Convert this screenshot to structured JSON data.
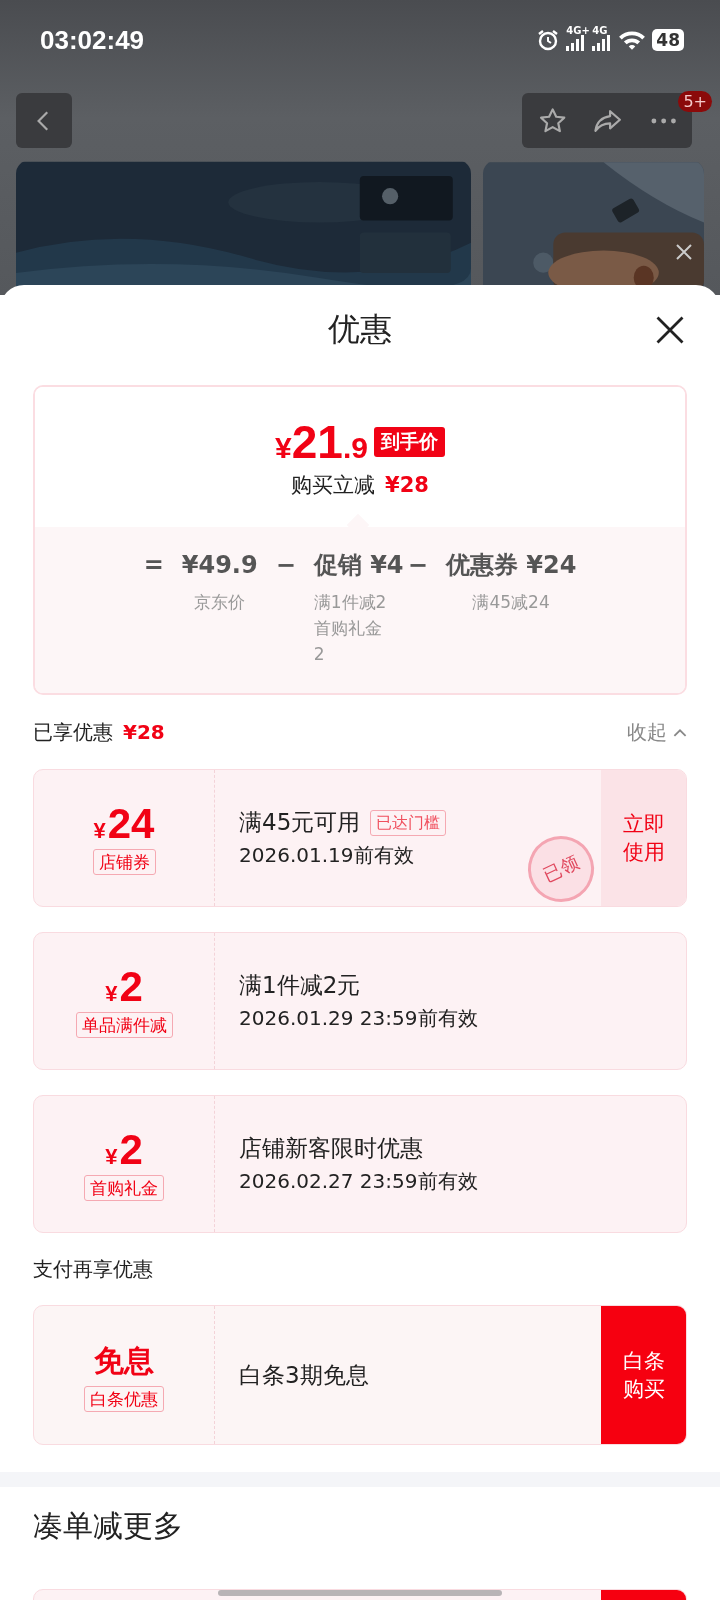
{
  "status_bar": {
    "time": "03:02:49",
    "network": [
      "4G+",
      "4G"
    ],
    "battery": "48"
  },
  "top_bar": {
    "badge": "5+"
  },
  "sheet": {
    "title": "优惠"
  },
  "summary": {
    "currency": "¥",
    "price_int": "21",
    "price_dec": ".9",
    "price_tag": "到手价",
    "saving_label": "购买立减",
    "saving_amount": "¥28",
    "formula": [
      {
        "kind": "operator",
        "text": "="
      },
      {
        "kind": "term",
        "text": "¥49.9",
        "notes": [
          "京东价"
        ]
      },
      {
        "kind": "operator",
        "text": "−"
      },
      {
        "kind": "term",
        "text": "促销 ¥4",
        "notes": [
          "满1件减2",
          "首购礼金2"
        ]
      },
      {
        "kind": "operator",
        "text": "−"
      },
      {
        "kind": "term",
        "text": "优惠券 ¥24",
        "notes": [
          "满45减24"
        ]
      }
    ]
  },
  "applied": {
    "label": "已享优惠",
    "amount": "¥28",
    "toggle": "收起",
    "expanded": true
  },
  "coupons": [
    {
      "currency": "¥",
      "amount": "24",
      "type": "店铺券",
      "title": "满45元可用",
      "tag": "已达门槛",
      "validity": "2026.01.19前有效",
      "action": {
        "label": "立即使用",
        "kind": "light"
      },
      "stamp": "已领"
    },
    {
      "currency": "¥",
      "amount": "2",
      "type": "单品满件减",
      "title": "满1件减2元",
      "validity": "2026.01.29 23:59前有效"
    },
    {
      "currency": "¥",
      "amount": "2",
      "type": "首购礼金",
      "title": "店铺新客限时优惠",
      "validity": "2026.02.27 23:59前有效"
    }
  ],
  "payment": {
    "heading": "支付再享优惠",
    "offers": [
      {
        "amount": "免息",
        "type": "白条优惠",
        "title": "白条3期免息",
        "action": {
          "label": "白条购买",
          "kind": "solid"
        }
      }
    ]
  },
  "more": {
    "heading": "凑单减更多"
  }
}
